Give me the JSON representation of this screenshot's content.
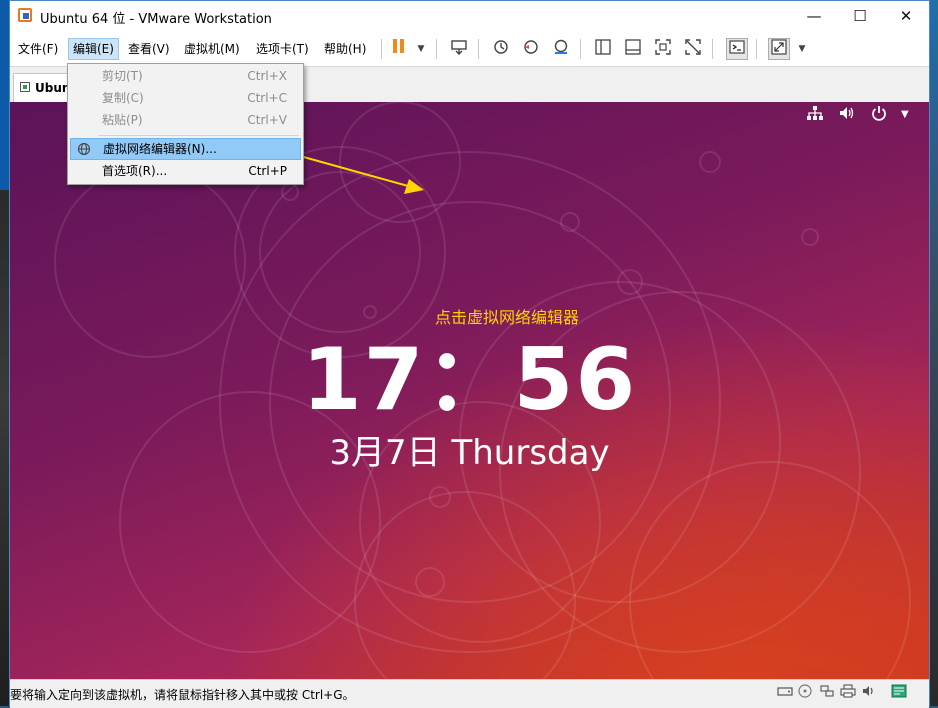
{
  "window": {
    "title": "Ubuntu 64 位 - VMware Workstation",
    "controls": [
      "minimize-icon",
      "maximize-icon",
      "close-icon"
    ]
  },
  "menubar": {
    "items": [
      "文件(F)",
      "编辑(E)",
      "查看(V)",
      "虚拟机(M)",
      "选项卡(T)",
      "帮助(H)"
    ],
    "active": "编辑(E)"
  },
  "toolbar": {
    "icons": [
      "pause-icon",
      "dropdown-arrow-icon",
      "send-ctrl-alt-del-icon",
      "snapshot-icon",
      "revert-snapshot-icon",
      "snapshot-manager-icon",
      "library-icon",
      "thumbnail-icon",
      "fullscreen-icon",
      "unity-icon",
      "console-icon",
      "stretch-icon",
      "dropdown-arrow-icon"
    ]
  },
  "tab": {
    "label": "Ubun"
  },
  "edit_menu": {
    "items": [
      {
        "label": "剪切(T)",
        "shortcut": "Ctrl+X",
        "enabled": false
      },
      {
        "label": "复制(C)",
        "shortcut": "Ctrl+C",
        "enabled": false
      },
      {
        "label": "粘贴(P)",
        "shortcut": "Ctrl+V",
        "enabled": false
      },
      {
        "label": "虚拟网络编辑器(N)...",
        "shortcut": "",
        "enabled": true,
        "highlighted": true,
        "icon": "globe-icon"
      },
      {
        "label": "首选项(R)...",
        "shortcut": "Ctrl+P",
        "enabled": true
      }
    ]
  },
  "guest": {
    "time": "17：56",
    "date": "3月7日 Thursday",
    "tray_icons": [
      "network-icon",
      "volume-icon",
      "power-icon",
      "chevron-down-icon"
    ]
  },
  "annotation": {
    "text": "点击虚拟网络编辑器",
    "color": "#ffd400"
  },
  "statusbar": {
    "text": "要将输入定向到该虚拟机，请将鼠标指针移入其中或按 Ctrl+G。",
    "icons": [
      "hard-disk-icon",
      "cd-icon",
      "network-adapter-icon",
      "printer-icon",
      "sound-icon",
      "message-icon"
    ]
  }
}
